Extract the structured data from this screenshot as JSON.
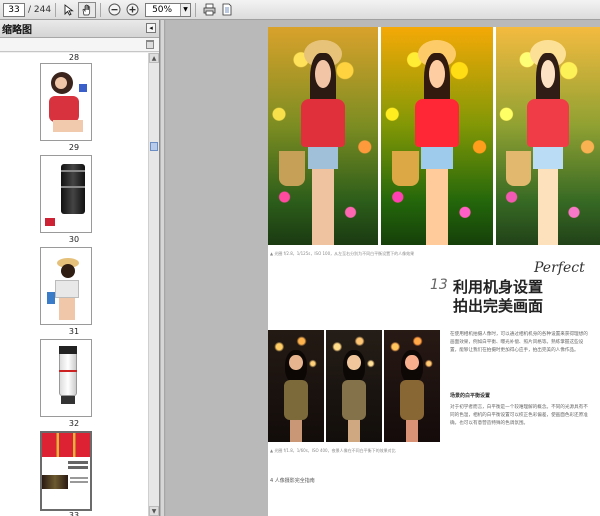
{
  "toolbar": {
    "current_page": "33",
    "total_pages": "/ 244",
    "zoom": "50%",
    "icons": [
      "select-arrow-icon",
      "hand-icon",
      "zoom-out-icon",
      "zoom-in-icon",
      "print-icon",
      "document-icon"
    ]
  },
  "sidebar": {
    "title": "缩略图",
    "thumbnails": [
      {
        "page": "28"
      },
      {
        "page": "29"
      },
      {
        "page": "30"
      },
      {
        "page": "31"
      },
      {
        "page": "32"
      },
      {
        "page": "33"
      }
    ]
  },
  "page": {
    "caption_top": "▲ 光圈 f/2.8，1/125s，ISO 100，从左至右分别为不同白平衡设置下的人像效果",
    "section_number": "13",
    "title_line1": "利用机身设置",
    "title_line2": "拍出完美画面",
    "script_word": "Perfect",
    "body_paragraph": "在使用相机拍摄人像时，可以通过相机机身的各种设置来获得理想的画面效果，例如白平衡、曝光补偿、照片风格等。熟练掌握这些设置，能够让我们在拍摄时更加得心应手，拍出完美的人像作品。",
    "subheading": "场景的白平衡设置",
    "sub_paragraph": "对于初学者而言，白平衡是一个较难理解的概念。不同的光源具有不同的色温，相机的白平衡设置可以校正色彩偏差，使画面色彩还原准确，也可以有意营造特殊的色调氛围。",
    "caption_bottom": "▲ 光圈 f/1.8，1/60s，ISO 400，夜景人像在不同白平衡下的效果对比",
    "footer": "4  人像摄影完全指南"
  }
}
